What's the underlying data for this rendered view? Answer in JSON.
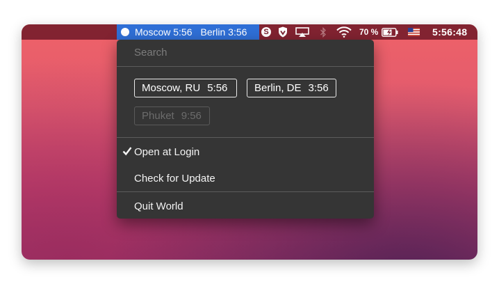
{
  "menubar": {
    "world": {
      "moscow": "Moscow 5:56",
      "berlin": "Berlin 3:56"
    },
    "skype_icon": "S",
    "battery_percent": "70 %",
    "clock": "5:56:48",
    "icons": [
      "skype-icon",
      "shield-icon",
      "airplay-icon",
      "bluetooth-icon",
      "wifi-icon",
      "battery-icon",
      "us-flag-icon"
    ]
  },
  "menu": {
    "search_placeholder": "Search",
    "cities": [
      {
        "name": "Moscow, RU",
        "time": "5:56",
        "state": "active"
      },
      {
        "name": "Berlin, DE",
        "time": "3:56",
        "state": "active"
      },
      {
        "name": "Phuket",
        "time": "9:56",
        "state": "disabled"
      }
    ],
    "items": {
      "open_at_login": "Open at Login",
      "check_update": "Check for Update",
      "quit": "Quit World"
    }
  },
  "colors": {
    "highlight": "#2f6fd6",
    "menu_bg": "#353535",
    "menubar_bg": "#7a1e2d"
  }
}
